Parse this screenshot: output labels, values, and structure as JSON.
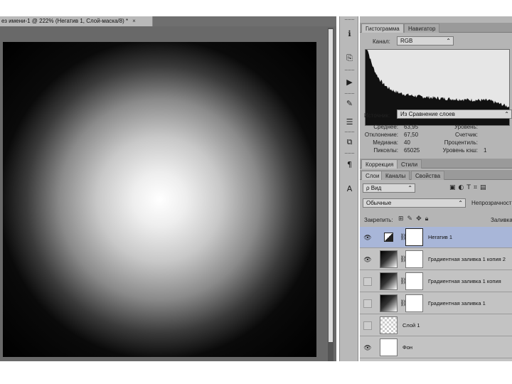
{
  "document": {
    "tab_title": "ез имени-1 @ 222% (Негатив 1, Слой-маска/8) *",
    "tab_close": "×"
  },
  "tools": [
    {
      "icon": "info-icon",
      "glyph": "ℹ"
    },
    {
      "icon": "history-icon",
      "glyph": "⎘"
    },
    {
      "icon": "actions-play-icon",
      "glyph": "▶"
    },
    {
      "icon": "brush-presets-icon",
      "glyph": "✎"
    },
    {
      "icon": "adjust-sliders-icon",
      "glyph": "☰"
    },
    {
      "icon": "layer-comps-icon",
      "glyph": "⧉"
    },
    {
      "icon": "paragraph-icon",
      "glyph": "¶"
    },
    {
      "icon": "character-icon",
      "glyph": "A"
    }
  ],
  "histogram_panel": {
    "tabs": [
      "Гистограмма",
      "Навигатор"
    ],
    "channel_label": "Канал:",
    "channel_value": "RGB",
    "source_label": "Источник:",
    "source_value": "Из Сравнение слоев",
    "stats": {
      "mean_label": "Среднее:",
      "mean": "63,95",
      "stddev_label": "Отклонение:",
      "stddev": "67,50",
      "median_label": "Медиана:",
      "median": "40",
      "pixels_label": "Пикселы:",
      "pixels": "65025",
      "level_label": "Уровень:",
      "level": "",
      "count_label": "Счетчик:",
      "count": "",
      "percentile_label": "Процентиль:",
      "percentile": "",
      "cache_label": "Уровень кэш:",
      "cache": "1"
    }
  },
  "adjust_panel": {
    "tabs": [
      "Коррекция",
      "Стили"
    ]
  },
  "layers_panel": {
    "tabs": [
      "Слои",
      "Каналы",
      "Свойства"
    ],
    "filter_value": "Вид",
    "blend_mode": "Обычные",
    "opacity_label": "Непрозрачность:",
    "lock_label": "Закрепить:",
    "fill_label": "Заливка:",
    "layers": [
      {
        "name": "Негатив 1",
        "visible": true,
        "type": "adjustment",
        "selected": true
      },
      {
        "name": "Градиентная заливка 1 копия 2",
        "visible": true,
        "type": "gradient",
        "selected": false
      },
      {
        "name": "Градиентная заливка 1 копия",
        "visible": false,
        "type": "gradient",
        "selected": false
      },
      {
        "name": "Градиентная заливка 1",
        "visible": false,
        "type": "gradient",
        "selected": false
      },
      {
        "name": "Слой 1",
        "visible": false,
        "type": "pixel",
        "selected": false
      },
      {
        "name": "Фон",
        "visible": true,
        "type": "background",
        "selected": false
      }
    ]
  }
}
